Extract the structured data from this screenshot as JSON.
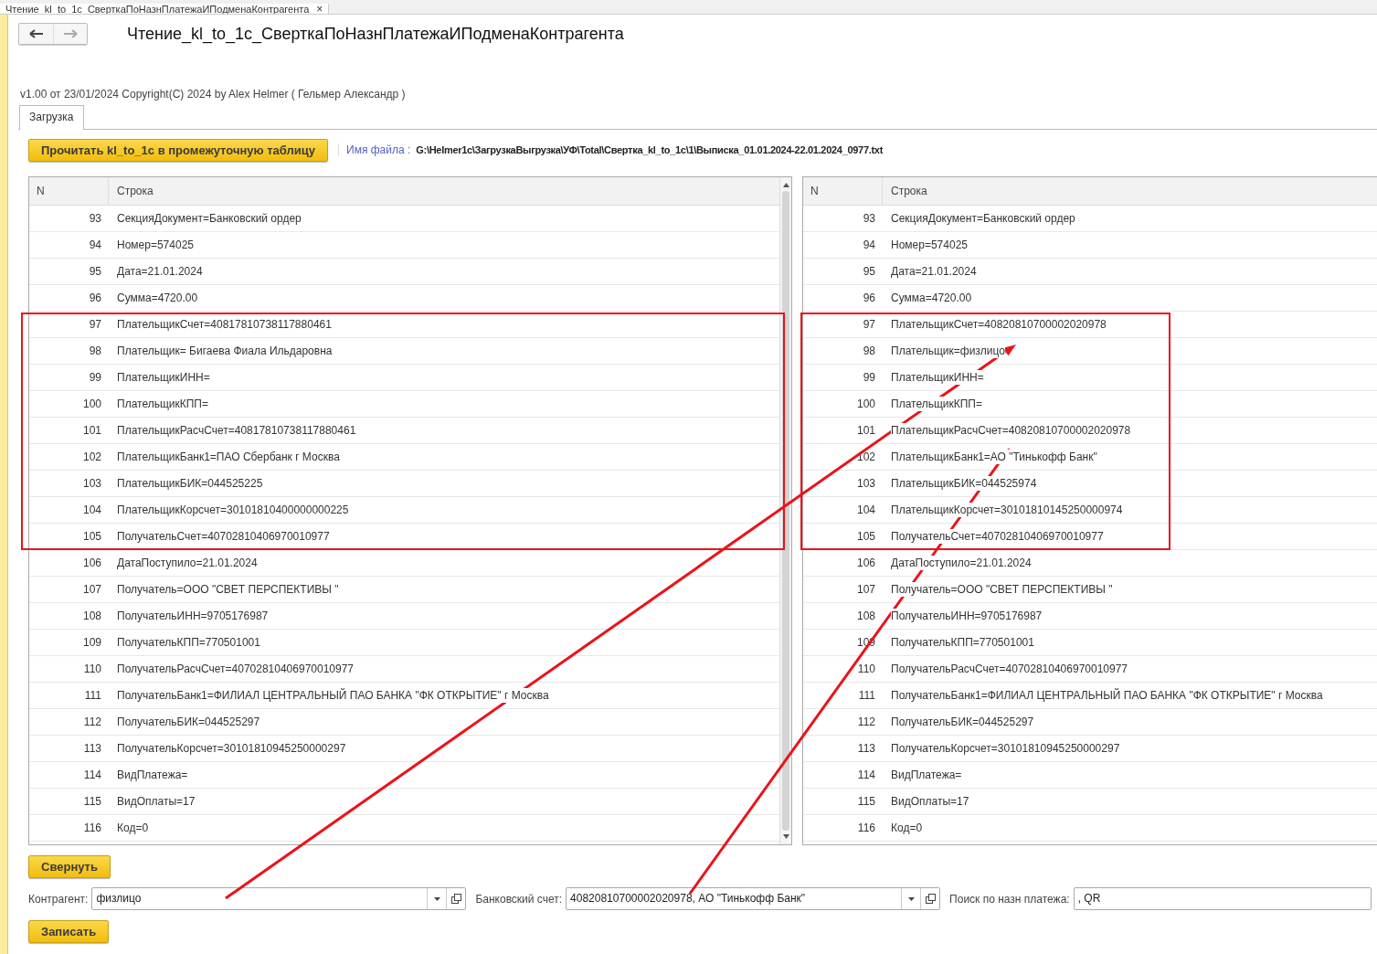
{
  "window_tab": {
    "title": "Чтение_kl_to_1c_СверткаПоНазнПлатежаИПодменаКонтрагента",
    "close": "×"
  },
  "title": "Чтение_kl_to_1c_СверткаПоНазнПлатежаИПодменаКонтрагента",
  "version": "v1.00 от 23/01/2024  Copyright(C) 2024 by Alex Helmer ( Гельмер Александр )",
  "form_tabs": [
    {
      "label": "Загрузка",
      "selected": true
    }
  ],
  "read_button": "Прочитать kl_to_1c в промежуточную таблицу",
  "file": {
    "label": "Имя файла :",
    "value": "G:\\Helmer1c\\ЗагрузкаВыгрузка\\УФ\\Total\\Свертка_kl_to_1c\\1\\Выписка_01.01.2024-22.01.2024_0977.txt"
  },
  "tables": [
    {
      "columns": [
        "N",
        "Строка"
      ],
      "rows": [
        {
          "n": "93",
          "text": "СекцияДокумент=Банковский ордер"
        },
        {
          "n": "94",
          "text": "Номер=574025"
        },
        {
          "n": "95",
          "text": "Дата=21.01.2024"
        },
        {
          "n": "96",
          "text": "Сумма=4720.00"
        },
        {
          "n": "97",
          "text": "ПлательщикСчет=40817810738117880461"
        },
        {
          "n": "98",
          "text": "Плательщик= Бигаева Фиала Ильдаровна"
        },
        {
          "n": "99",
          "text": "ПлательщикИНН="
        },
        {
          "n": "100",
          "text": "ПлательщикКПП="
        },
        {
          "n": "101",
          "text": "ПлательщикРасчСчет=40817810738117880461"
        },
        {
          "n": "102",
          "text": "ПлательщикБанк1=ПАО Сбербанк г Москва"
        },
        {
          "n": "103",
          "text": "ПлательщикБИК=044525225"
        },
        {
          "n": "104",
          "text": "ПлательщикКорсчет=30101810400000000225"
        },
        {
          "n": "105",
          "text": "ПолучательСчет=40702810406970010977"
        },
        {
          "n": "106",
          "text": "ДатаПоступило=21.01.2024"
        },
        {
          "n": "107",
          "text": "Получатель=ООО \"СВЕТ ПЕРСПЕКТИВЫ \""
        },
        {
          "n": "108",
          "text": "ПолучательИНН=9705176987"
        },
        {
          "n": "109",
          "text": "ПолучательКПП=770501001"
        },
        {
          "n": "110",
          "text": "ПолучательРасчСчет=40702810406970010977"
        },
        {
          "n": "111",
          "text": "ПолучательБанк1=ФИЛИАЛ ЦЕНТРАЛЬНЫЙ ПАО БАНКА \"ФК ОТКРЫТИЕ\" г Москва"
        },
        {
          "n": "112",
          "text": "ПолучательБИК=044525297"
        },
        {
          "n": "113",
          "text": "ПолучательКорсчет=30101810945250000297"
        },
        {
          "n": "114",
          "text": "ВидПлатежа="
        },
        {
          "n": "115",
          "text": "ВидОплаты=17"
        },
        {
          "n": "116",
          "text": "Код=0"
        }
      ]
    },
    {
      "columns": [
        "N",
        "Строка"
      ],
      "rows": [
        {
          "n": "93",
          "text": "СекцияДокумент=Банковский ордер"
        },
        {
          "n": "94",
          "text": "Номер=574025"
        },
        {
          "n": "95",
          "text": "Дата=21.01.2024"
        },
        {
          "n": "96",
          "text": "Сумма=4720.00"
        },
        {
          "n": "97",
          "text": "ПлательщикСчет=40820810700002020978"
        },
        {
          "n": "98",
          "text": "Плательщик=физлицо"
        },
        {
          "n": "99",
          "text": "ПлательщикИНН="
        },
        {
          "n": "100",
          "text": "ПлательщикКПП="
        },
        {
          "n": "101",
          "text": "ПлательщикРасчСчет=40820810700002020978"
        },
        {
          "n": "102",
          "text": "ПлательщикБанк1=АО \"Тинькофф Банк\""
        },
        {
          "n": "103",
          "text": "ПлательщикБИК=044525974"
        },
        {
          "n": "104",
          "text": "ПлательщикКорсчет=30101810145250000974"
        },
        {
          "n": "105",
          "text": "ПолучательСчет=40702810406970010977"
        },
        {
          "n": "106",
          "text": "ДатаПоступило=21.01.2024"
        },
        {
          "n": "107",
          "text": "Получатель=ООО \"СВЕТ ПЕРСПЕКТИВЫ \""
        },
        {
          "n": "108",
          "text": "ПолучательИНН=9705176987"
        },
        {
          "n": "109",
          "text": "ПолучательКПП=770501001"
        },
        {
          "n": "110",
          "text": "ПолучательРасчСчет=40702810406970010977"
        },
        {
          "n": "111",
          "text": "ПолучательБанк1=ФИЛИАЛ ЦЕНТРАЛЬНЫЙ ПАО БАНКА \"ФК ОТКРЫТИЕ\" г Москва"
        },
        {
          "n": "112",
          "text": "ПолучательБИК=044525297"
        },
        {
          "n": "113",
          "text": "ПолучательКорсчет=30101810945250000297"
        },
        {
          "n": "114",
          "text": "ВидПлатежа="
        },
        {
          "n": "115",
          "text": "ВидОплаты=17"
        },
        {
          "n": "116",
          "text": "Код=0"
        }
      ]
    }
  ],
  "collapse_button": "Свернуть",
  "fields": [
    {
      "kind": "combo",
      "label": "Контрагент:",
      "value": "физлицо"
    },
    {
      "kind": "combo",
      "label": "Банковский счет:",
      "value": "40820810700002020978, АО \"Тинькофф Банк\""
    },
    {
      "kind": "text",
      "label": "Поиск по назн платежа:",
      "value": ", QR"
    }
  ],
  "save_button": "Записать"
}
